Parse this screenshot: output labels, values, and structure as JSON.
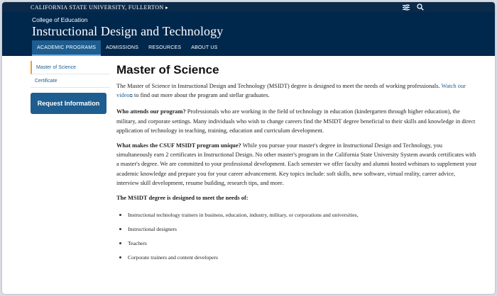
{
  "topbar": {
    "university": "CALIFORNIA STATE UNIVERSITY, FULLERTON",
    "university_arrow": "▸",
    "icons": [
      "filter-icon",
      "search-icon"
    ]
  },
  "header": {
    "college": "College of Education",
    "department": "Instructional Design and Technology"
  },
  "nav": {
    "items": [
      "ACADEMIC PROGRAMS",
      "ADMISSIONS",
      "RESOURCES",
      "ABOUT US"
    ],
    "active": "ACADEMIC PROGRAMS"
  },
  "sidebar": {
    "items": [
      "Master of Science",
      "Certificate"
    ],
    "active": "Master of Science",
    "button": "Request Information"
  },
  "content": {
    "title": "Master of Science",
    "intro_pre": "The Master of Science in Instructional Design and Technology (MSIDT) degree is designed to meet the needs of working professionals.",
    "intro_link": "Watch our video",
    "intro_post": "to find out more about the program and stellar graduates.",
    "q1": "Who attends our program?",
    "a1": "Professionals who are working in the field of technology in education (kindergarten through higher education), the military, and corporate settings. Many individuals who wish to change careers find the MSIDT degree beneficial to their skills and knowledge in direct application of technology in teaching, training, education and curriculum development.",
    "q2": "What makes the CSUF MSIDT program unique?",
    "a2": "While you pursue your master's degree in Instructional Design and Technology, you simultaneously earn 2 certificates in Instructional Design. No other master's program in the California State University System awards certificates with a master's degree. We are committed to your professional development. Each semester we offer faculty and alumni hosted webinars to supplement your academic knowledge and prepare you for your career advancement. Key topics include:  soft skills, new software, virtual reality, career advice, interview skill development, resume building, research tips, and more.",
    "needs_heading": "The MSIDT degree is designed to meet the needs of:",
    "needs": [
      "Instructional technology trainers in business, education, industry, military, or corporations and universities,",
      "Instructional designers",
      "Teachers",
      "Corporate trainers and content developers"
    ]
  },
  "colors": {
    "navy": "#00274c",
    "topbar": "#0b2a4a",
    "accent_blue": "#1e5d8f",
    "accent_orange": "#f29a30"
  }
}
